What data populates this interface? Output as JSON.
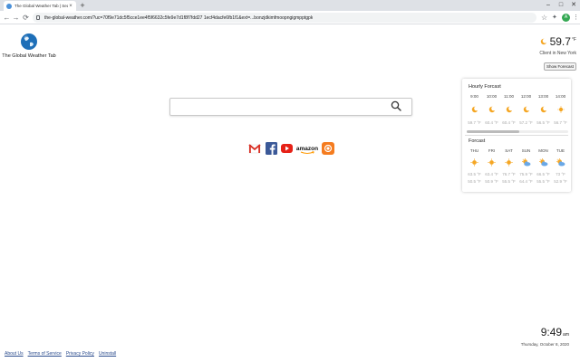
{
  "browser": {
    "tab_title": "The Global Weather Tab | Search",
    "url": "the-global-weather.com/?uc=70f9e71dc5f5cce1ee4f5f6632c5fe9e7d1f8f7fdd27 1ecf4dacfe6fb1f1&ext=...bonzjdkimfmoopngigmpptgpk",
    "tab_close": "×",
    "new_tab": "+",
    "minimize": "–",
    "maximize": "□",
    "close": "✕",
    "back": "←",
    "forward": "→",
    "reload": "⟳",
    "bookmark": "☆",
    "extensions": "✦",
    "profile": "A",
    "menu": "⋮"
  },
  "brand": {
    "name": "The Global Weather Tab"
  },
  "weather": {
    "temp": "59.7",
    "unit": "°F",
    "city": "Client in New York",
    "show_forecast_label": "Show Forecast"
  },
  "hourly": {
    "title": "Hourly Forcast",
    "times": [
      "9:00",
      "10:00",
      "11:00",
      "12:00",
      "13:00",
      "14:00"
    ],
    "icons": [
      "moon",
      "moon",
      "moon",
      "moon",
      "moon",
      "sun"
    ],
    "temps": [
      "59.7 °F",
      "60.4 °F",
      "60.4 °F",
      "57.2 °F",
      "56.5 °F",
      "56.7 °F"
    ]
  },
  "daily": {
    "title": "Forcast",
    "days": [
      "THU",
      "FRI",
      "SAT",
      "SUN",
      "MON",
      "TUE"
    ],
    "icons": [
      "sun",
      "sun",
      "sun",
      "partly-cloudy",
      "partly-cloudy",
      "partly-cloudy"
    ],
    "highs": [
      "63.5 °F",
      "63.4 °F",
      "76.7 °F",
      "75.9 °F",
      "66.5 °F",
      "73 °F"
    ],
    "lows": [
      "50.5 °F",
      "50.9 °F",
      "55.5 °F",
      "64.4 °F",
      "55.5 °F",
      "52.9 °F"
    ]
  },
  "search": {
    "placeholder": ""
  },
  "shortcuts": [
    "gmail",
    "facebook",
    "youtube",
    "amazon",
    "weather"
  ],
  "amazon_label": "amazon",
  "clock": {
    "time": "9:49",
    "ampm": "am",
    "date": "Thursday, October 8, 2020"
  },
  "footer": {
    "about": "About Us",
    "terms": "Terms of Service",
    "privacy": "Privacy Policy",
    "uninstall": "Uninstall"
  },
  "colors": {
    "sun": "#f5a623",
    "cloud": "#6aa8e6",
    "gmail": "#d93025",
    "facebook": "#3b5998",
    "youtube": "#e62117",
    "weather_app": "#f57c1f"
  }
}
